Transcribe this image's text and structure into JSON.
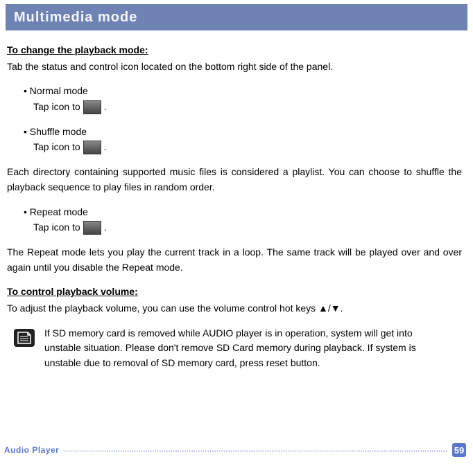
{
  "title": "Multimedia mode",
  "section1_heading": "To change the playback mode:",
  "section1_intro": "Tab the status and control icon located on the bottom right side of the panel.",
  "bullets": {
    "normal": {
      "label": "Normal mode",
      "tap_pre": "Tap icon to ",
      "tap_post": "."
    },
    "shuffle": {
      "label": "Shuffle mode",
      "tap_pre": "Tap icon to ",
      "tap_post": "."
    },
    "repeat": {
      "label": "Repeat mode",
      "tap_pre": "Tap icon to ",
      "tap_post": "."
    }
  },
  "shuffle_para": "Each directory containing supported music files is considered a playlist. You can choose to shuffle the playback sequence to play files in random order.",
  "repeat_para": "The Repeat mode lets you play the current track in a loop. The same track will be played over and over again until you disable the Repeat mode.",
  "section2_heading": "To control playback volume:",
  "section2_text": "To adjust the playback volume, you can use the volume control hot keys ▲/▼.",
  "note": "If SD memory card is removed while AUDIO player is in operation, system will get into unstable situation. Please don't remove SD Card memory during playback. If system is unstable due to removal of SD memory card, press reset button.",
  "footer_label": "Audio Player",
  "page_number": "59",
  "bullet_mark": "•  "
}
